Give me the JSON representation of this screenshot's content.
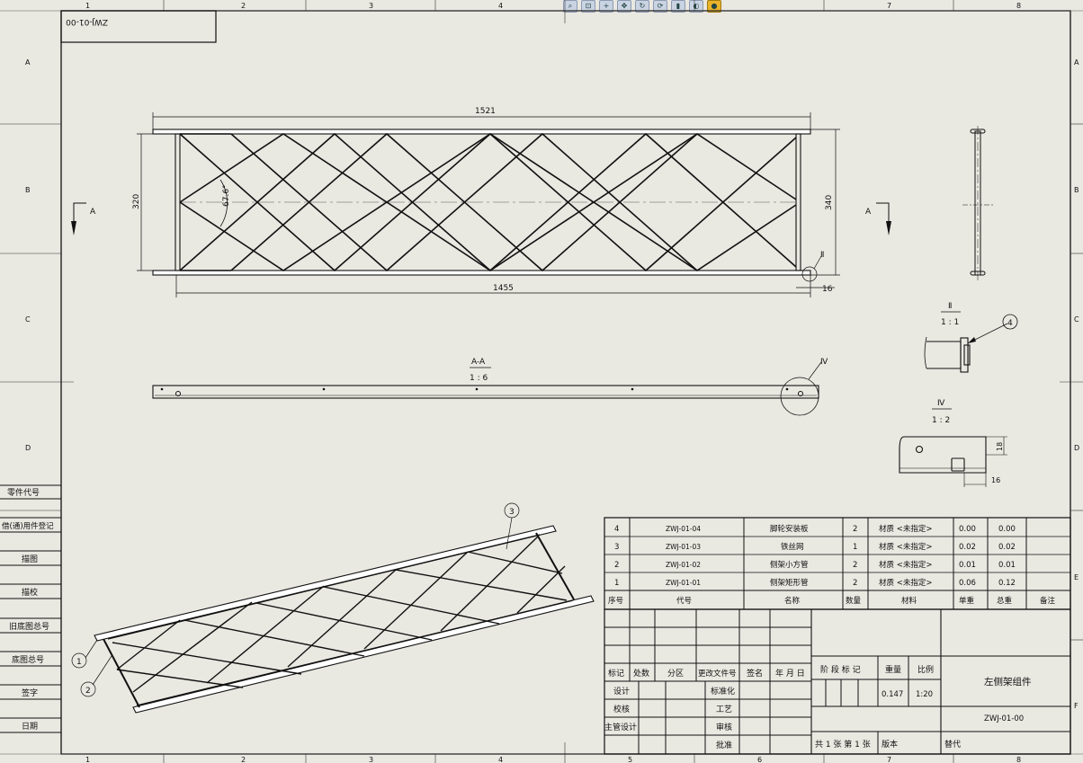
{
  "mirrored_title_tag": "ZWJ-01-00",
  "toolbar": {
    "icons": [
      "zoom-fit-icon",
      "zoom-area-icon",
      "zoom-in-icon",
      "pan-icon",
      "rotate-icon",
      "refresh-icon",
      "view-orient-icon",
      "display-style-icon",
      "appearance-icon"
    ]
  },
  "border": {
    "columns": [
      "1",
      "2",
      "3",
      "4",
      "5",
      "6",
      "7",
      "8"
    ],
    "rows": [
      "A",
      "B",
      "C",
      "D",
      "E",
      "F"
    ]
  },
  "left_column": {
    "labels": [
      "零件代号",
      "借(通)用件登记",
      "描图",
      "描校",
      "旧底图总号",
      "底图总号",
      "签字",
      "日期"
    ]
  },
  "main_view": {
    "dim_length_total": "1521",
    "dim_length_inner": "1455",
    "dim_height_left": "320",
    "dim_height_right": "340",
    "dim_angle": "67.6°",
    "dim_end_gap": "16",
    "detail_callout": "Ⅱ",
    "section_label_left": "A",
    "section_label_right": "A"
  },
  "section_view": {
    "title": "A-A",
    "scale": "1 : 6",
    "detail_callout": "Ⅳ"
  },
  "detail_ii": {
    "title": "Ⅱ",
    "scale": "1 : 1",
    "balloon": "4"
  },
  "detail_iv": {
    "title": "Ⅳ",
    "scale": "1 : 2",
    "dim_height": "18",
    "dim_width": "16"
  },
  "iso_view": {
    "balloons": [
      "1",
      "2",
      "3"
    ]
  },
  "bom": {
    "rows": [
      {
        "no": "4",
        "code": "ZWJ-01-04",
        "name": "脚轮安装板",
        "qty": "2",
        "material": "材质 <未指定>",
        "unit": "0.00",
        "total": "0.00",
        "note": ""
      },
      {
        "no": "3",
        "code": "ZWJ-01-03",
        "name": "铁丝网",
        "qty": "1",
        "material": "材质 <未指定>",
        "unit": "0.02",
        "total": "0.02",
        "note": ""
      },
      {
        "no": "2",
        "code": "ZWJ-01-02",
        "name": "侧架小方管",
        "qty": "2",
        "material": "材质 <未指定>",
        "unit": "0.01",
        "total": "0.01",
        "note": ""
      },
      {
        "no": "1",
        "code": "ZWJ-01-01",
        "name": "侧架矩形管",
        "qty": "2",
        "material": "材质 <未指定>",
        "unit": "0.06",
        "total": "0.12",
        "note": ""
      }
    ],
    "header": {
      "no": "序号",
      "code": "代号",
      "name": "名称",
      "qty": "数量",
      "material": "材料",
      "unit": "单重",
      "total": "总重",
      "note": "备注"
    }
  },
  "title_block": {
    "revision_headers": [
      "标记",
      "处数",
      "分区",
      "更改文件号",
      "签名",
      "年 月 日"
    ],
    "role_labels": [
      "设计",
      "校核",
      "主管设计"
    ],
    "approval_labels": [
      "标准化",
      "工艺",
      "审核",
      "批准"
    ],
    "stage_label": "阶 段 标 记",
    "weight_label": "重量",
    "scale_label": "比例",
    "weight_value": "0.147",
    "scale_value": "1:20",
    "drawing_title": "左侧架组件",
    "drawing_number": "ZWJ-01-00",
    "sheet_info": "共 1 张  第 1 张",
    "version_label": "版本",
    "replace_label": "替代"
  }
}
